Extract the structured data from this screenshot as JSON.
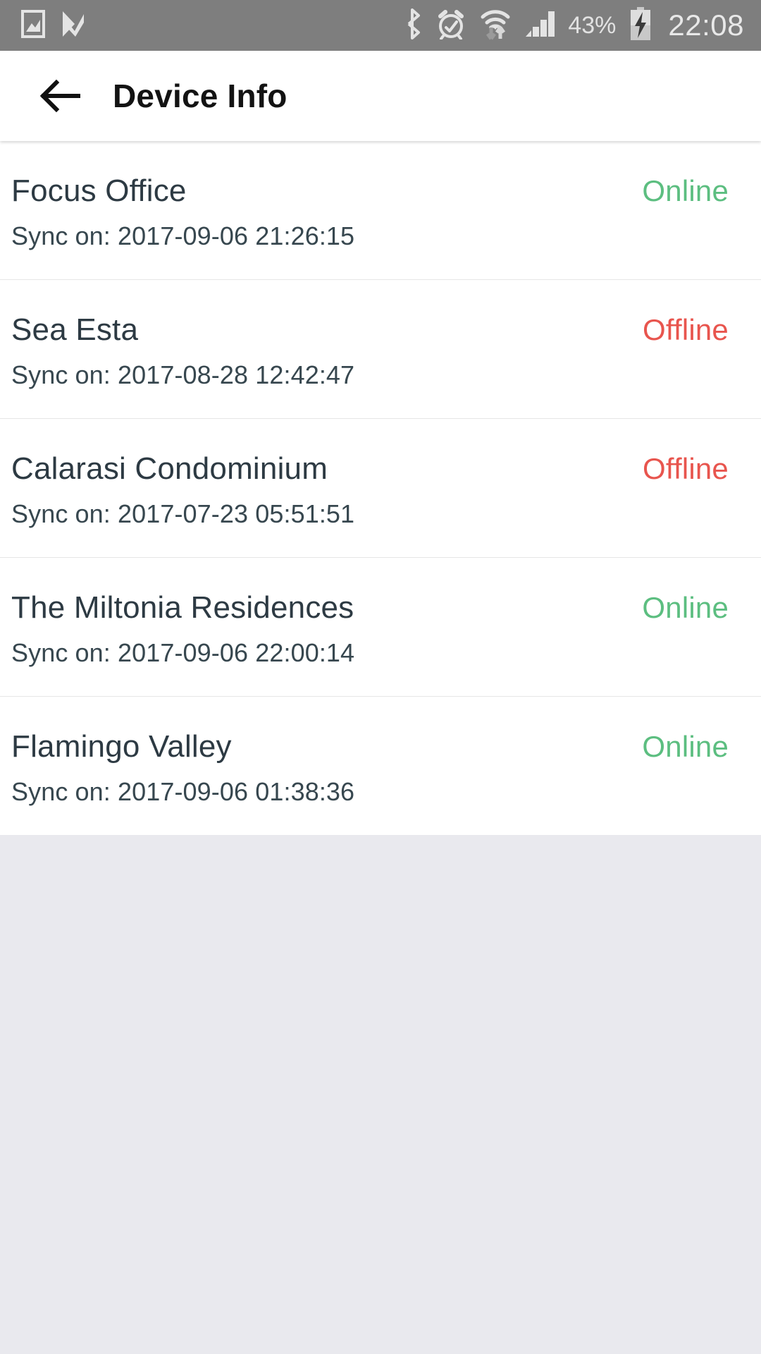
{
  "status_bar": {
    "time": "22:08",
    "battery_percent": "43%",
    "left_icons": [
      "screenshot-icon",
      "task-check-icon"
    ],
    "right_icons": [
      "bluetooth-icon",
      "alarm-icon",
      "wifi-data-icon",
      "cellular-signal-icon",
      "battery-charging-icon"
    ],
    "background_color": "#7e7e7e"
  },
  "app_bar": {
    "back_label": "back-arrow",
    "title": "Device Info"
  },
  "colors": {
    "online": "#5CBE80",
    "offline": "#E8554E",
    "device_name": "#2d3a43",
    "page_background": "#e9e9ee"
  },
  "devices": [
    {
      "name": "Focus Office",
      "status": "Online",
      "sync": "Sync on: 2017-09-06 21:26:15"
    },
    {
      "name": "Sea Esta",
      "status": "Offline",
      "sync": "Sync on: 2017-08-28 12:42:47"
    },
    {
      "name": "Calarasi Condominium",
      "status": "Offline",
      "sync": "Sync on: 2017-07-23 05:51:51"
    },
    {
      "name": "The Miltonia Residences",
      "status": "Online",
      "sync": "Sync on: 2017-09-06 22:00:14"
    },
    {
      "name": "Flamingo Valley",
      "status": "Online",
      "sync": "Sync on: 2017-09-06 01:38:36"
    }
  ]
}
